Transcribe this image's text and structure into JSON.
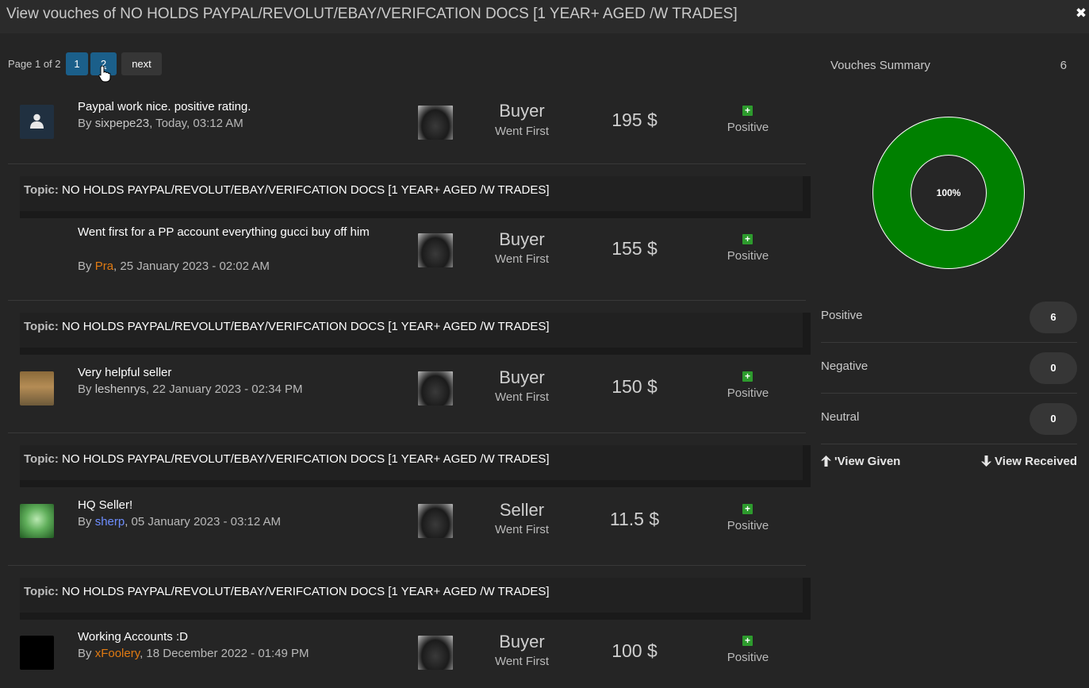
{
  "window": {
    "title": "View vouches of NO HOLDS PAYPAL/REVOLUT/EBAY/VERIFCATION DOCS [1 YEAR+ AGED /W TRADES]",
    "close_icon": "✖"
  },
  "pagination": {
    "info": "Page 1 of 2",
    "pages": [
      "1",
      "2"
    ],
    "next_label": "next"
  },
  "vouches": [
    {
      "message": "Paypal work nice. positive rating.",
      "by": "By ",
      "user": "sixpepe23",
      "date": ", Today, 03:12 AM",
      "role": "Buyer",
      "went_first": "Went First",
      "amount": "195 $",
      "rating": "Positive"
    },
    {
      "message": "Went first for a PP account everything gucci buy off him",
      "by": "By ",
      "user": "Pra",
      "date": ", 25 January 2023 - 02:02 AM",
      "role": "Buyer",
      "went_first": "Went First",
      "amount": "155 $",
      "rating": "Positive"
    },
    {
      "message": "Very helpful seller",
      "by": "By ",
      "user": "leshenrys",
      "date": ", 22 January 2023 - 02:34 PM",
      "role": "Buyer",
      "went_first": "Went First",
      "amount": "150 $",
      "rating": "Positive"
    },
    {
      "message": "HQ Seller!",
      "by": "By ",
      "user": "sherp",
      "date": ", 05 January 2023 - 03:12 AM",
      "role": "Seller",
      "went_first": "Went First",
      "amount": "11.5 $",
      "rating": "Positive"
    },
    {
      "message": "Working Accounts :D",
      "by": "By ",
      "user": "xFoolery",
      "date": ", 18 December 2022 - 01:49 PM",
      "role": "Buyer",
      "went_first": "Went First",
      "amount": "100 $",
      "rating": "Positive"
    }
  ],
  "topic": {
    "label": "Topic:",
    "name": " NO HOLDS PAYPAL/REVOLUT/EBAY/VERIFCATION DOCS [1 YEAR+ AGED /W TRADES]"
  },
  "summary": {
    "heading": "Vouches Summary",
    "total": "6",
    "donut_label": "100%",
    "positive_fraction": 1.0,
    "positive_color": "#008000",
    "stats": [
      {
        "label": "Positive",
        "value": "6"
      },
      {
        "label": "Negative",
        "value": "0"
      },
      {
        "label": "Neutral",
        "value": "0"
      }
    ],
    "view_given": "'View Given",
    "view_received": "View Received"
  }
}
